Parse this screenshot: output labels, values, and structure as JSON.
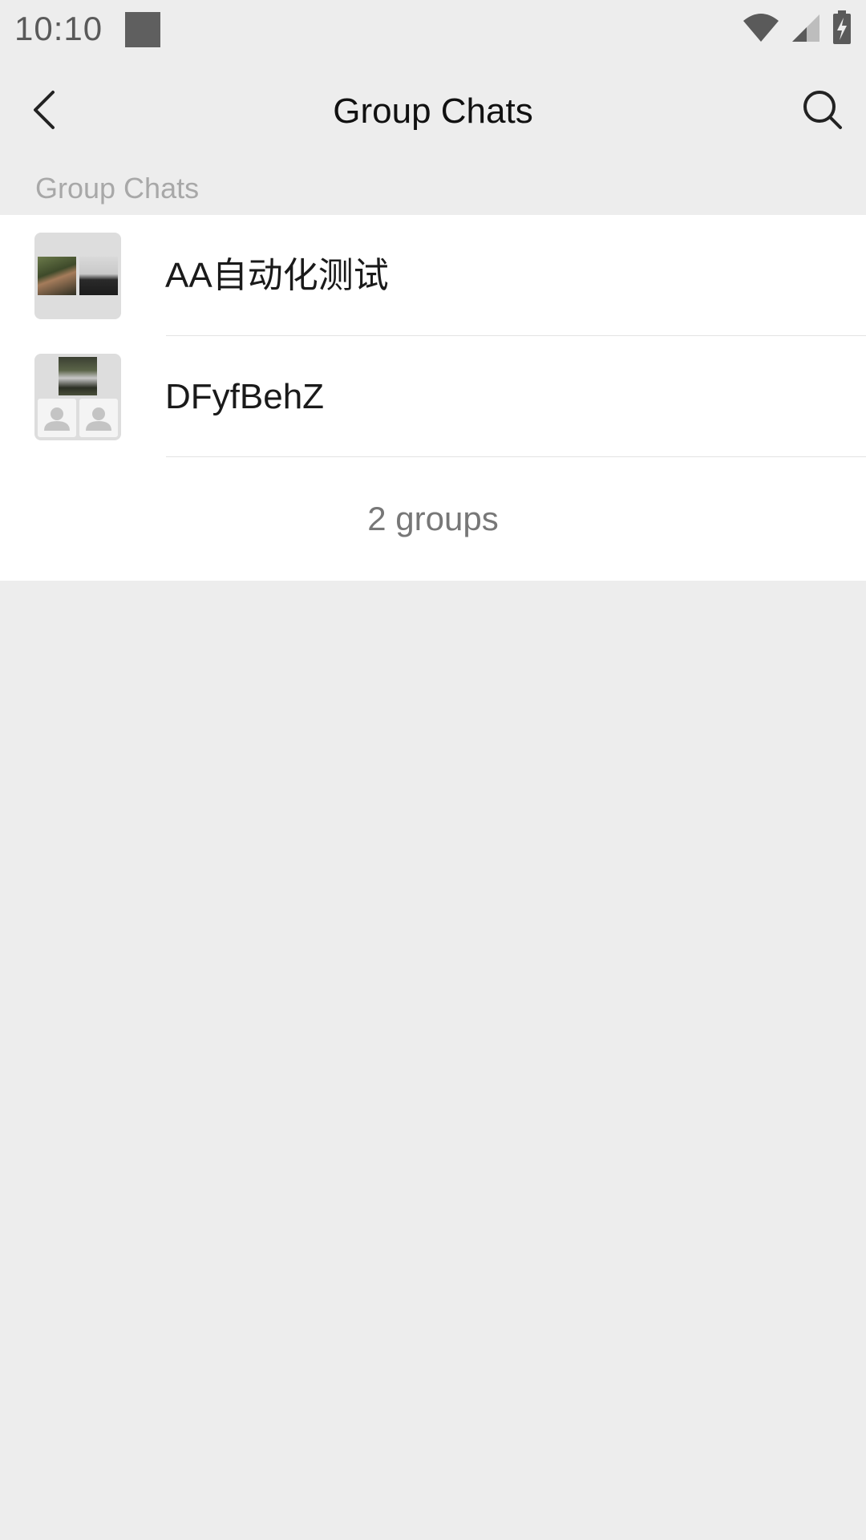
{
  "status_bar": {
    "time": "10:10",
    "icons": [
      "notification-icon",
      "wifi-icon",
      "cellular-signal-icon",
      "battery-charging-icon"
    ]
  },
  "app_bar": {
    "title": "Group Chats",
    "back_icon": "chevron-left-icon",
    "search_icon": "search-icon"
  },
  "section": {
    "header": "Group Chats"
  },
  "groups": [
    {
      "name": "AA自动化测试",
      "avatar": "group-avatar-two-photos"
    },
    {
      "name": "DFyfBehZ",
      "avatar": "group-avatar-three-members"
    }
  ],
  "footer": {
    "count_text": "2 groups"
  },
  "colors": {
    "background": "#ededed",
    "list_background": "#ffffff",
    "section_header_text": "#a8a8a8",
    "count_text": "#777777"
  }
}
